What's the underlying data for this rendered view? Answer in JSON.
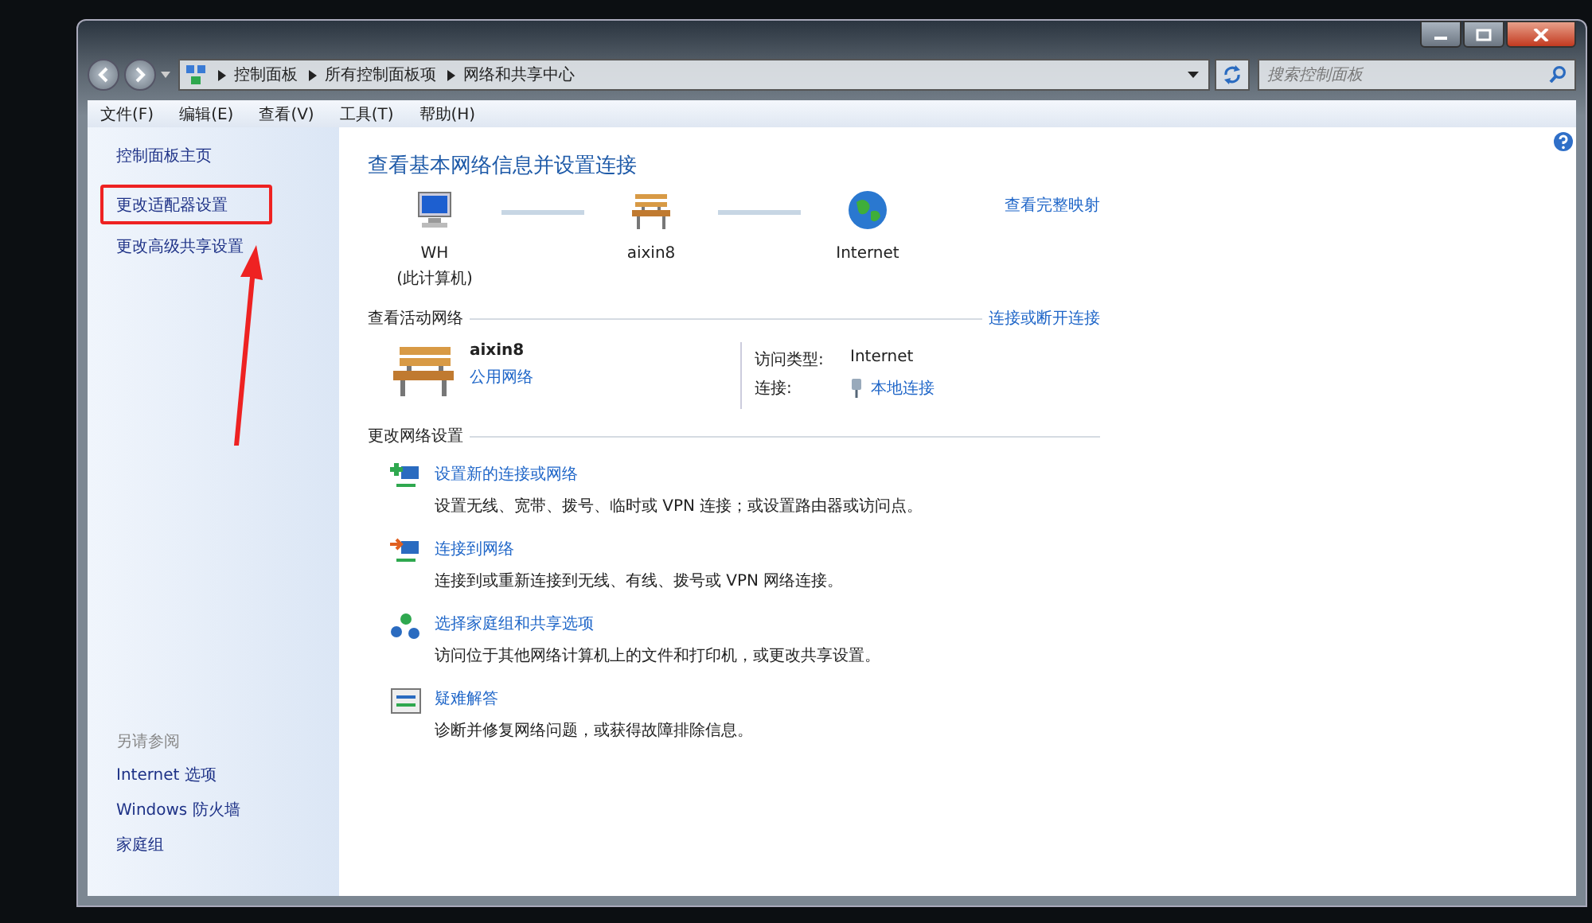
{
  "address_bar": {
    "breadcrumbs": [
      "控制面板",
      "所有控制面板项",
      "网络和共享中心"
    ]
  },
  "search": {
    "placeholder": "搜索控制面板"
  },
  "menu": [
    "文件(F)",
    "编辑(E)",
    "查看(V)",
    "工具(T)",
    "帮助(H)"
  ],
  "sidebar": {
    "items": [
      {
        "label": "控制面板主页",
        "highlighted": false
      },
      {
        "label": "更改适配器设置",
        "highlighted": true
      },
      {
        "label": "更改高级共享设置",
        "highlighted": false
      }
    ],
    "see_also_title": "另请参阅",
    "see_also": [
      "Internet 选项",
      "Windows 防火墙",
      "家庭组"
    ]
  },
  "main": {
    "title": "查看基本网络信息并设置连接",
    "map": {
      "nodes": [
        {
          "kind": "computer",
          "label": "WH",
          "sublabel": "(此计算机)"
        },
        {
          "kind": "network",
          "label": "aixin8"
        },
        {
          "kind": "internet",
          "label": "Internet"
        }
      ],
      "link": "查看完整映射"
    },
    "active": {
      "heading": "查看活动网络",
      "link": "连接或断开连接",
      "network_name": "aixin8",
      "network_type": "公用网络",
      "access_label": "访问类型:",
      "access_value": "Internet",
      "connection_label": "连接:",
      "connection_value": "本地连接"
    },
    "change": {
      "heading": "更改网络设置",
      "tasks": [
        {
          "kind": "new",
          "title": "设置新的连接或网络",
          "description": "设置无线、宽带、拨号、临时或 VPN 连接；或设置路由器或访问点。"
        },
        {
          "kind": "connect",
          "title": "连接到网络",
          "description": "连接到或重新连接到无线、有线、拨号或 VPN 网络连接。"
        },
        {
          "kind": "homegroup",
          "title": "选择家庭组和共享选项",
          "description": "访问位于其他网络计算机上的文件和打印机，或更改共享设置。"
        },
        {
          "kind": "troubleshoot",
          "title": "疑难解答",
          "description": "诊断并修复网络问题，或获得故障排除信息。"
        }
      ]
    }
  }
}
